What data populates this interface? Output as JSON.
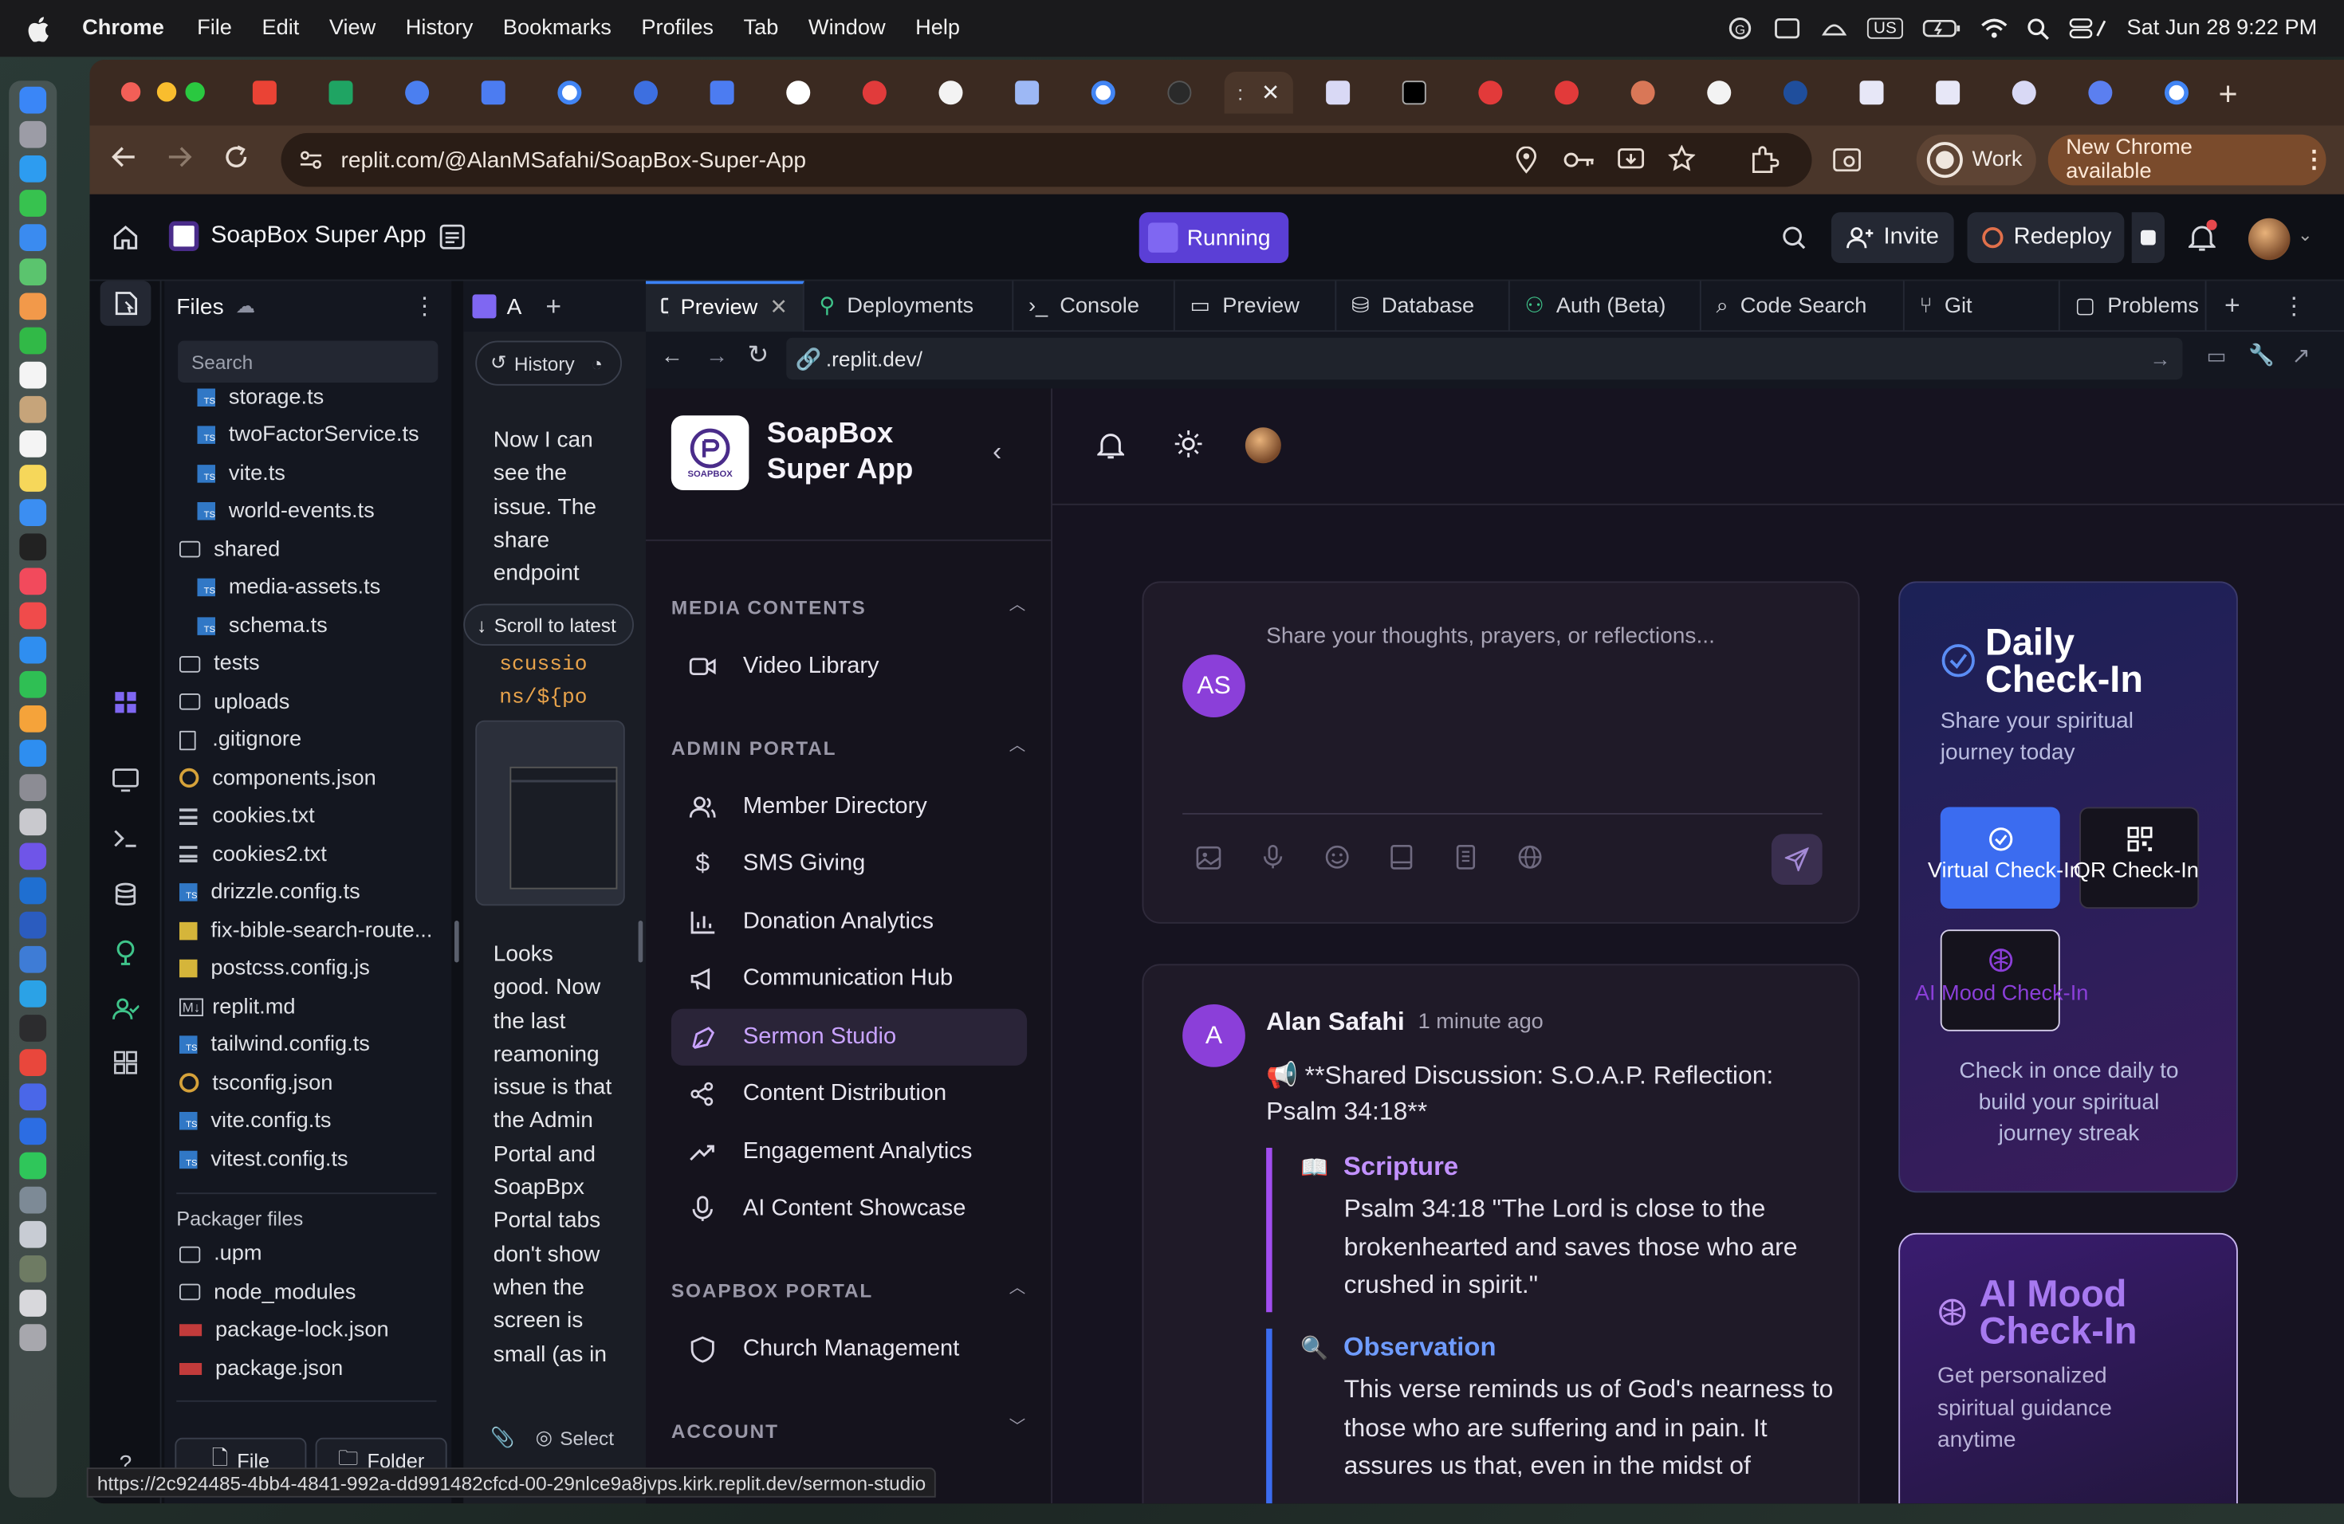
{
  "menubar": {
    "app": "Chrome",
    "items": [
      "File",
      "Edit",
      "View",
      "History",
      "Bookmarks",
      "Profiles",
      "Tab",
      "Window",
      "Help"
    ],
    "input_source": "US",
    "clock": "Sat Jun 28  9:22 PM"
  },
  "browser": {
    "url": "replit.com/@AlanMSafahi/SoapBox-Super-App",
    "profile": "Work",
    "update_label": "New Chrome available"
  },
  "replit": {
    "project_name": "SoapBox Super App",
    "run_status": "Running",
    "invite_label": "Invite",
    "redeploy_label": "Redeploy"
  },
  "files": {
    "title": "Files",
    "search_placeholder": "Search",
    "items": [
      {
        "name": "storage.ts",
        "type": "ts",
        "indent": 1
      },
      {
        "name": "twoFactorService.ts",
        "type": "ts",
        "indent": 1
      },
      {
        "name": "vite.ts",
        "type": "ts",
        "indent": 1
      },
      {
        "name": "world-events.ts",
        "type": "ts",
        "indent": 1
      },
      {
        "name": "shared",
        "type": "folder",
        "indent": 0
      },
      {
        "name": "media-assets.ts",
        "type": "ts",
        "indent": 1
      },
      {
        "name": "schema.ts",
        "type": "ts",
        "indent": 1
      },
      {
        "name": "tests",
        "type": "folder",
        "indent": 0
      },
      {
        "name": "uploads",
        "type": "folder",
        "indent": 0
      },
      {
        "name": ".gitignore",
        "type": "doc",
        "indent": 0
      },
      {
        "name": "components.json",
        "type": "json",
        "indent": 0
      },
      {
        "name": "cookies.txt",
        "type": "txt",
        "indent": 0
      },
      {
        "name": "cookies2.txt",
        "type": "txt",
        "indent": 0
      },
      {
        "name": "drizzle.config.ts",
        "type": "ts",
        "indent": 0
      },
      {
        "name": "fix-bible-search-route...",
        "type": "js",
        "indent": 0
      },
      {
        "name": "postcss.config.js",
        "type": "js",
        "indent": 0
      },
      {
        "name": "replit.md",
        "type": "md",
        "indent": 0
      },
      {
        "name": "tailwind.config.ts",
        "type": "ts",
        "indent": 0
      },
      {
        "name": "tsconfig.json",
        "type": "json",
        "indent": 0
      },
      {
        "name": "vite.config.ts",
        "type": "ts",
        "indent": 0
      },
      {
        "name": "vitest.config.ts",
        "type": "ts",
        "indent": 0
      }
    ],
    "packager_title": "Packager files",
    "packager_items": [
      {
        "name": ".upm",
        "type": "folder"
      },
      {
        "name": "node_modules",
        "type": "folder"
      },
      {
        "name": "package-lock.json",
        "type": "pkg"
      },
      {
        "name": "package.json",
        "type": "pkg"
      }
    ],
    "new_file": "File",
    "new_folder": "Folder"
  },
  "agent": {
    "tab_label": "A",
    "history_label": "History",
    "message1": "Now I can see the issue. The share endpoint",
    "scroll_latest": "Scroll to latest",
    "code_snippet": "scussio\nns/${po\natId}/s",
    "message2": "Looks good. Now the last reamoning issue is that the Admin Portal and SoapBpx Portal tabs don't show when the screen is small (as in",
    "select_label": "Select"
  },
  "workspace_tabs": [
    "Preview",
    "Deployments",
    "Console",
    "Preview",
    "Database",
    "Auth (Beta)",
    "Code Search",
    "Git",
    "Problems"
  ],
  "preview_url": ".replit.dev/",
  "app": {
    "brand_line1": "SoapBox",
    "brand_line2": "Super App",
    "logo_text": "SOAPBOX",
    "sections": [
      {
        "title": "MEDIA CONTENTS",
        "items": [
          "Video Library"
        ]
      },
      {
        "title": "ADMIN PORTAL",
        "items": [
          "Member Directory",
          "SMS Giving",
          "Donation Analytics",
          "Communication Hub",
          "Sermon Studio",
          "Content Distribution",
          "Engagement Analytics",
          "AI Content Showcase"
        ]
      },
      {
        "title": "SOAPBOX PORTAL",
        "items": [
          "Church Management"
        ]
      },
      {
        "title": "ACCOUNT",
        "items": []
      }
    ],
    "composer": {
      "avatar": "AS",
      "placeholder": "Share your thoughts, prayers, or reflections..."
    },
    "post": {
      "avatar": "A",
      "author": "Alan Safahi",
      "time": "1 minute ago",
      "headline": "📢 **Shared Discussion: S.O.A.P. Reflection: Psalm 34:18**",
      "scripture_title": "Scripture",
      "scripture_icon": "📖",
      "scripture_text": "Psalm 34:18 \"The Lord is close to the brokenhearted and saves those who are crushed in spirit.\"",
      "observation_title": "Observation",
      "observation_icon": "🔍",
      "observation_text": "This verse reminds us of God's nearness to those who are suffering and in pain. It assures us that, even in the midst of"
    },
    "checkin": {
      "title_line1": "Daily",
      "title_line2": "Check-In",
      "subtitle": "Share your spiritual journey today",
      "virtual": "Virtual Check-In",
      "qr": "QR Check-In",
      "mood": "AI Mood Check-In",
      "footer": "Check in once daily to build your spiritual journey streak"
    },
    "mood_card": {
      "title_line1": "AI Mood",
      "title_line2": "Check-In",
      "subtitle": "Get personalized spiritual guidance anytime"
    }
  },
  "status_url": "https://2c924485-4bb4-4841-992a-dd991482cfcd-00-29nlce9a8jvps.kirk.replit.dev/sermon-studio",
  "colors": {
    "accent": "#8b3fd9",
    "running": "#5b3fd6",
    "checkin_blue": "#3b6cf0"
  }
}
